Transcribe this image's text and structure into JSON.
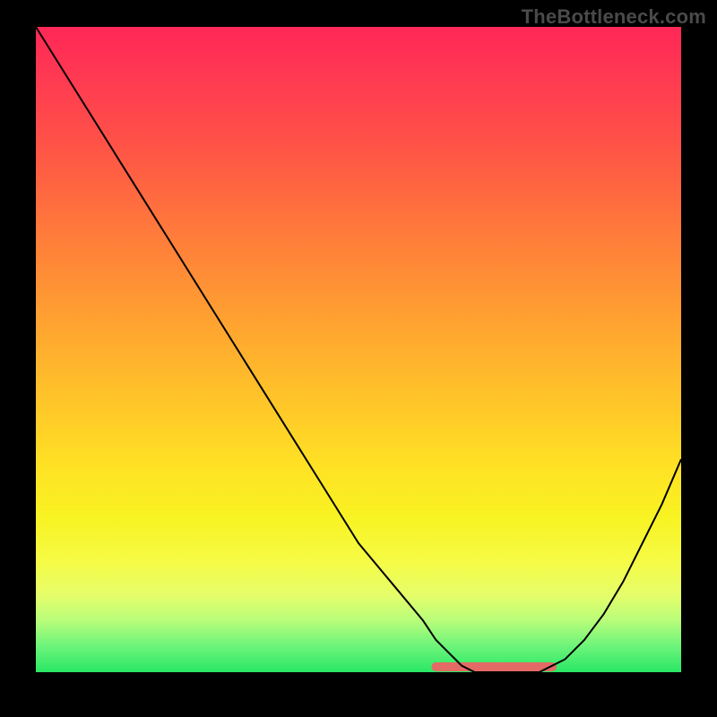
{
  "watermark": "TheBottleneck.com",
  "colors": {
    "background": "#000000",
    "gradient_top": "#ff2757",
    "gradient_bottom": "#29e765",
    "curve": "#000000",
    "highlight": "#e46a65"
  },
  "chart_data": {
    "type": "line",
    "title": "",
    "xlabel": "",
    "ylabel": "",
    "xlim": [
      0,
      100
    ],
    "ylim": [
      0,
      100
    ],
    "grid": false,
    "series": [
      {
        "name": "bottleneck-curve",
        "x": [
          0,
          5,
          10,
          15,
          20,
          25,
          30,
          35,
          40,
          45,
          50,
          55,
          60,
          62,
          64,
          66,
          68,
          70,
          72,
          74,
          76,
          78,
          80,
          82,
          85,
          88,
          91,
          94,
          97,
          100
        ],
        "y": [
          100,
          92,
          84,
          76,
          68,
          60,
          52,
          44,
          36,
          28,
          20,
          14,
          8,
          5,
          3,
          1,
          0,
          0,
          0,
          0,
          0,
          0,
          1,
          2,
          5,
          9,
          14,
          20,
          26,
          33
        ]
      },
      {
        "name": "optimal-range",
        "x": [
          62,
          80
        ],
        "y": [
          0,
          0
        ]
      }
    ],
    "annotations": [
      {
        "text": "TheBottleneck.com",
        "position": "top-right"
      }
    ]
  }
}
